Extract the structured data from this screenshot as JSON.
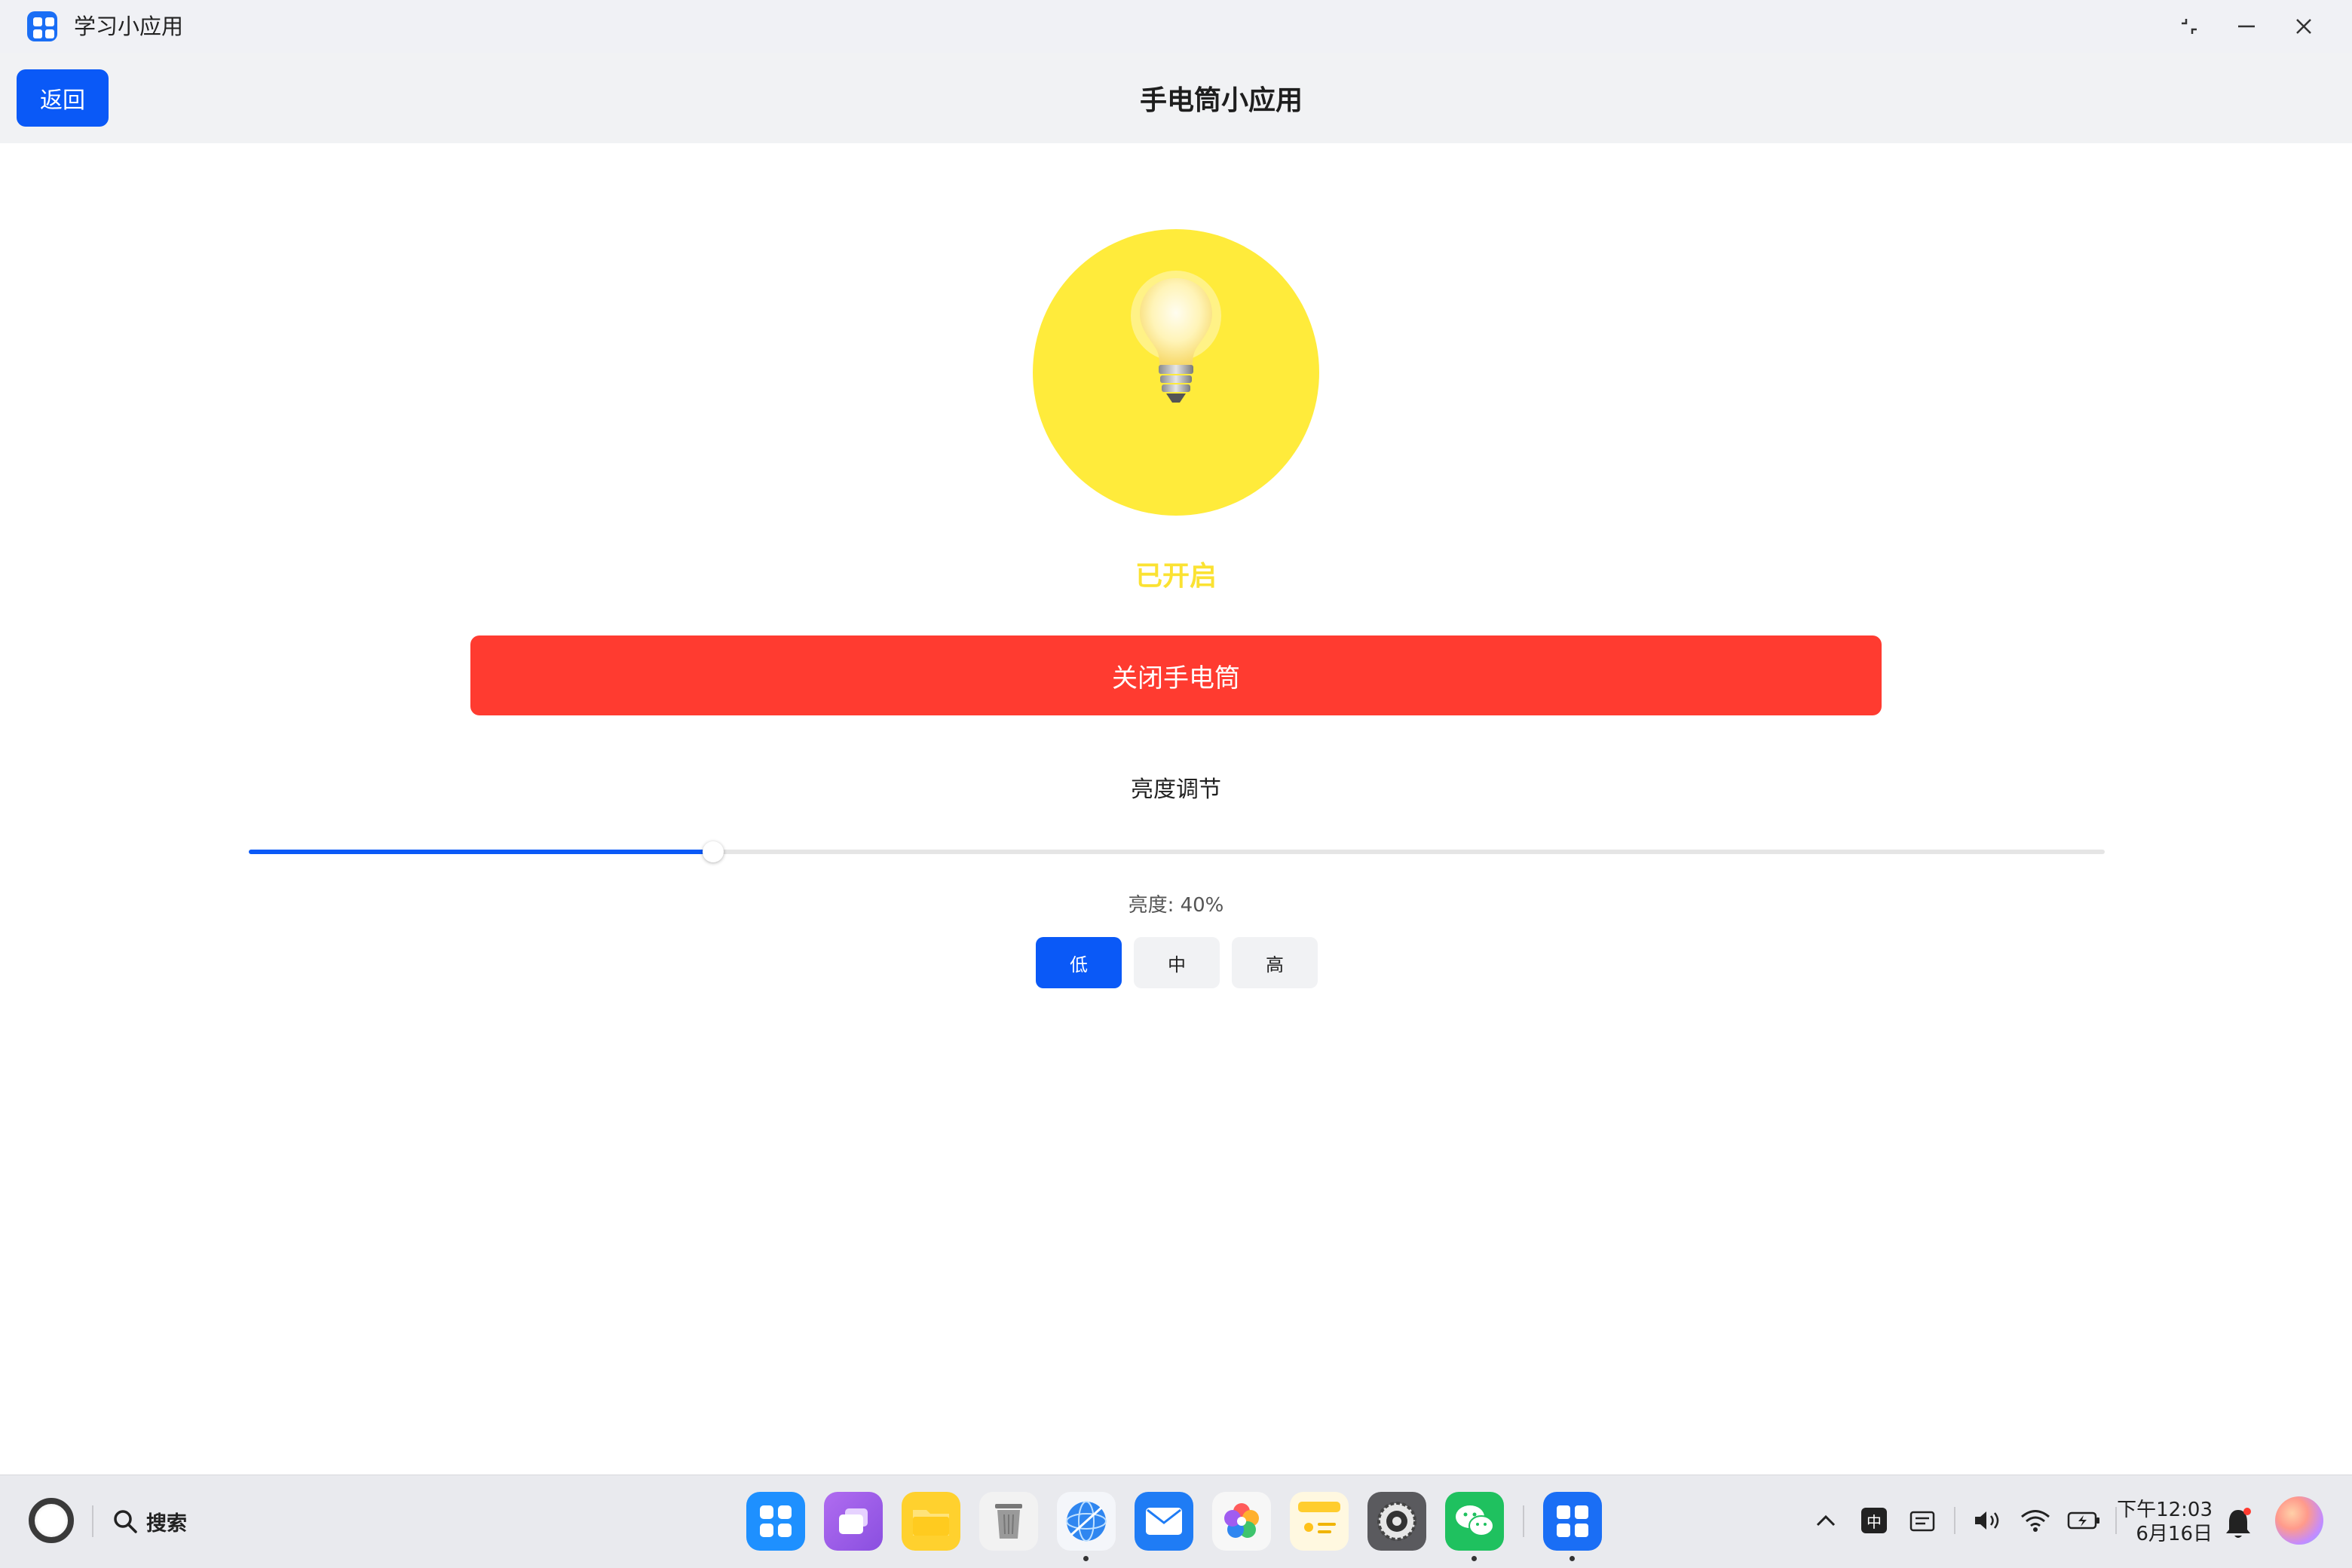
{
  "window": {
    "title": "学习小应用"
  },
  "header": {
    "back_label": "返回",
    "title": "手电筒小应用"
  },
  "flashlight": {
    "status": "已开启",
    "toggle_label": "关闭手电筒",
    "on_color": "#ffeb3b",
    "toggle_color": "#ff3b30"
  },
  "brightness": {
    "title": "亮度调节",
    "value_text": "亮度: 40%",
    "level": 0.25,
    "levels": [
      "低",
      "中",
      "高"
    ],
    "selected_level": "低"
  },
  "taskbar": {
    "search_label": "搜索",
    "dock_icons": [
      "app-launcher-icon",
      "multitask-icon",
      "files-icon",
      "trash-icon",
      "browser-icon",
      "mail-icon",
      "gallery-icon",
      "notes-icon",
      "settings-icon",
      "wechat-icon",
      "study-app-icon"
    ],
    "ime_label": "中",
    "time": "下午12:03",
    "date": "6月16日"
  },
  "accent_color": "#0a59f7"
}
